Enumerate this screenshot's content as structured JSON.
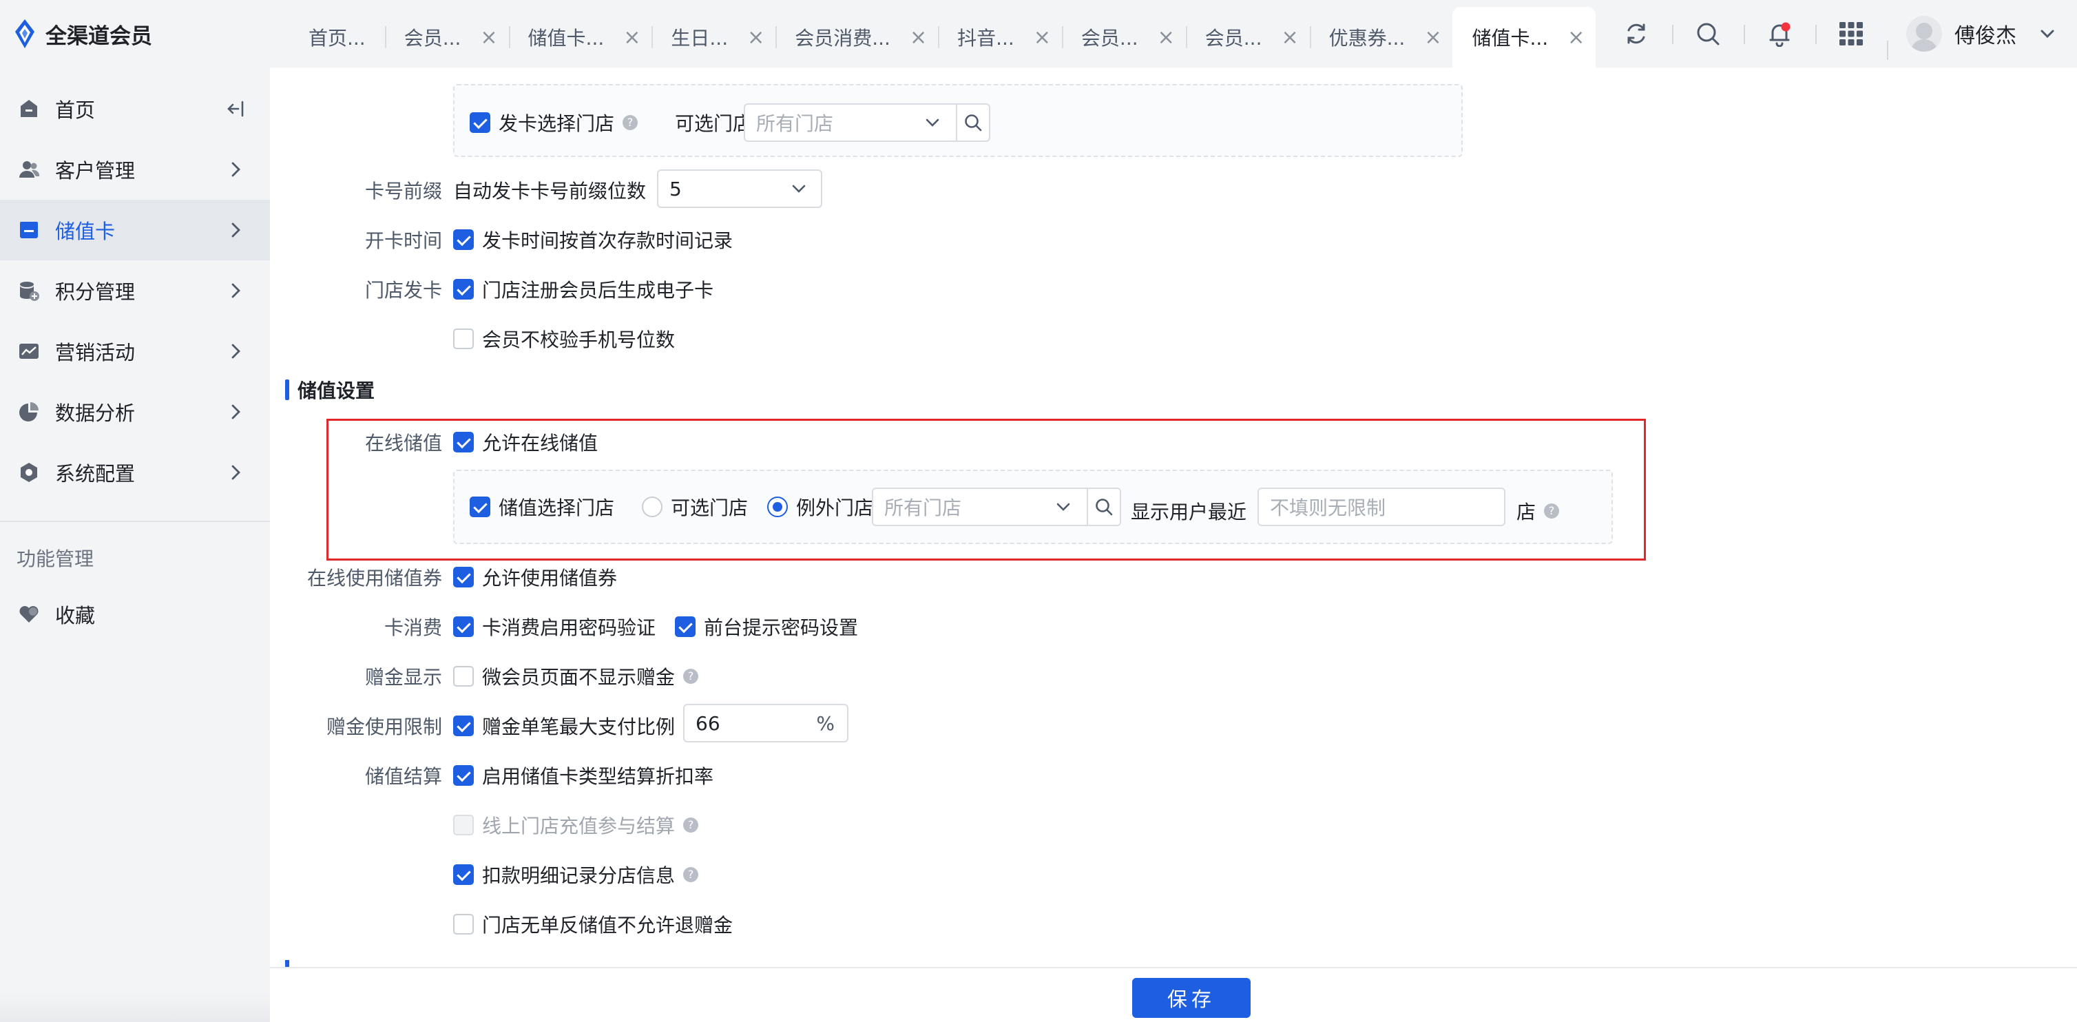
{
  "app": {
    "title": "全渠道会员",
    "brand_color": "#1d5fe0",
    "highlight_color": "#e0272c"
  },
  "tabs": [
    {
      "label": "首页...",
      "closable": false
    },
    {
      "label": "会员...",
      "closable": true
    },
    {
      "label": "储值卡...",
      "closable": true
    },
    {
      "label": "生日...",
      "closable": true
    },
    {
      "label": "会员消费...",
      "closable": true
    },
    {
      "label": "抖音...",
      "closable": true
    },
    {
      "label": "会员...",
      "closable": true
    },
    {
      "label": "会员...",
      "closable": true
    },
    {
      "label": "优惠券...",
      "closable": true
    },
    {
      "label": "储值卡...",
      "closable": true,
      "active": true
    }
  ],
  "tab_close_glyph": "×",
  "topbar": {
    "icons": [
      "refresh-icon",
      "search-icon",
      "notification-bell-icon",
      "app-grid-icon"
    ],
    "user_name": "傅俊杰",
    "user_chevron": "⌄"
  },
  "sidebar": {
    "items": [
      {
        "label": "首页",
        "icon": "home-icon",
        "action": "collapse-sidebar-icon"
      },
      {
        "label": "客户管理",
        "icon": "customer-icon"
      },
      {
        "label": "储值卡",
        "icon": "card-icon",
        "active": true
      },
      {
        "label": "积分管理",
        "icon": "points-icon"
      },
      {
        "label": "营销活动",
        "icon": "marketing-icon"
      },
      {
        "label": "数据分析",
        "icon": "analytics-icon"
      },
      {
        "label": "系统配置",
        "icon": "settings-icon"
      }
    ],
    "section_title": "功能管理",
    "favorites_label": "收藏"
  },
  "form": {
    "card_issue_store": {
      "checkbox_label": "发卡选择门店",
      "checked": true,
      "optional_label": "可选门店",
      "store_placeholder": "所有门店"
    },
    "card_prefix": {
      "label": "卡号前缀",
      "text": "自动发卡卡号前缀位数",
      "value": "5"
    },
    "open_time": {
      "label": "开卡时间",
      "checkbox_label": "发卡时间按首次存款时间记录",
      "checked": true
    },
    "store_issue": {
      "label": "门店发卡",
      "checkbox_label": "门店注册会员后生成电子卡",
      "checked": true,
      "extra_label": "会员不校验手机号位数",
      "extra_checked": false
    },
    "section_stored_value": "储值设置",
    "online_stored": {
      "label": "在线储值",
      "checkbox_label": "允许在线储值",
      "checked": true,
      "store_select_label": "储值选择门店",
      "store_select_checked": true,
      "radio_optional": "可选门店",
      "radio_except": "例外门店",
      "radio_selected": "例外门店",
      "store_placeholder": "所有门店",
      "show_recent_label": "显示用户最近",
      "recent_placeholder": "不填则无限制",
      "unit": "店"
    },
    "online_coupon": {
      "label": "在线使用储值券",
      "checkbox_label": "允许使用储值券",
      "checked": true
    },
    "card_consume": {
      "label": "卡消费",
      "checkbox_label": "卡消费启用密码验证",
      "checked": true,
      "extra_label": "前台提示密码设置",
      "extra_checked": true
    },
    "gift_display": {
      "label": "赠金显示",
      "checkbox_label": "微会员页面不显示赠金",
      "checked": false
    },
    "gift_limit": {
      "label": "赠金使用限制",
      "checkbox_label": "赠金单笔最大支付比例",
      "checked": true,
      "value": "66",
      "unit": "%"
    },
    "settlement": {
      "label": "储值结算",
      "options": [
        {
          "label": "启用储值卡类型结算折扣率",
          "checked": true,
          "disabled": false,
          "help": false
        },
        {
          "label": "线上门店充值参与结算",
          "checked": false,
          "disabled": true,
          "help": true
        },
        {
          "label": "扣款明细记录分店信息",
          "checked": true,
          "disabled": false,
          "help": true
        },
        {
          "label": "门店无单反储值不允许退赠金",
          "checked": false,
          "disabled": false,
          "help": false
        }
      ]
    },
    "help_glyph": "?"
  },
  "footer": {
    "save_label": "保存"
  }
}
